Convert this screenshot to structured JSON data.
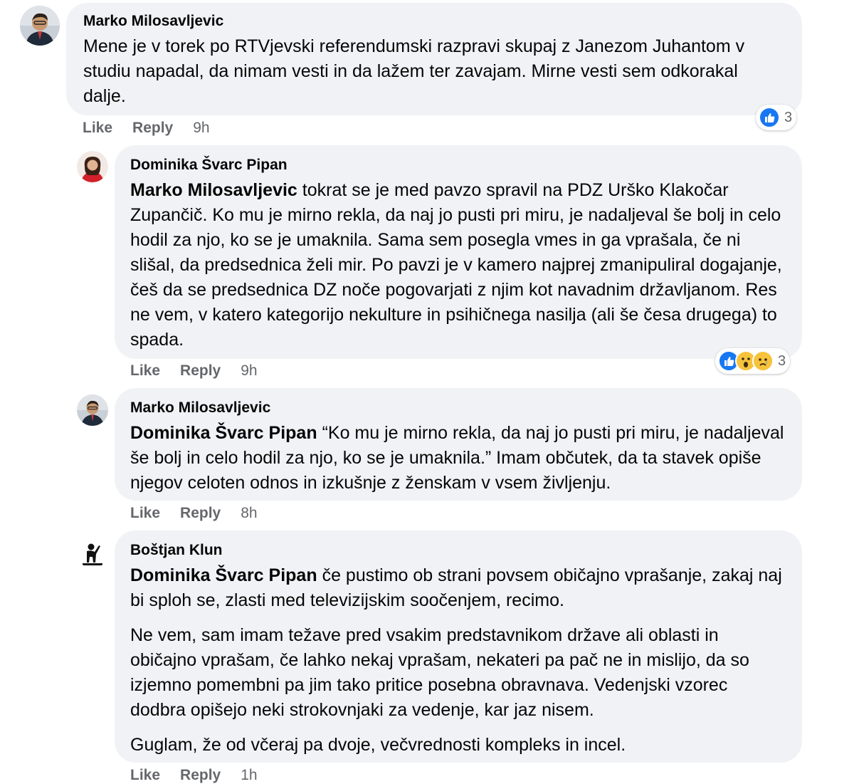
{
  "comments": [
    {
      "author": "Marko Milosavljevic",
      "mention": "",
      "paragraphs": [
        "Mene je v torek po RTVjevski referendumski razpravi skupaj z Janezom Juhantom v studiu napadal, da nimam vesti in da lažem ter zavajam. Mirne vesti sem odkorakal dalje."
      ],
      "like_label": "Like",
      "reply_label": "Reply",
      "time": "9h",
      "reactions": [
        "like-icon"
      ],
      "reaction_count": "3"
    },
    {
      "author": "Dominika Švarc Pipan",
      "mention": "Marko Milosavljevic",
      "paragraphs": [
        "tokrat se je med pavzo spravil na PDZ Urško Klakočar Zupančič. Ko mu je mirno rekla, da naj jo pusti pri miru, je nadaljeval še bolj in celo hodil za njo, ko se je umaknila. Sama sem posegla vmes in ga vprašala, če ni slišal, da predsednica želi mir. Po pavzi je v kamero najprej zmanipuliral dogajanje, češ da se predsednica DZ noče pogovarjati z njim kot navadnim državljanom. Res ne vem, v katero kategorijo nekulture in psihičnega nasilja (ali še česa drugega) to spada."
      ],
      "like_label": "Like",
      "reply_label": "Reply",
      "time": "9h",
      "reactions": [
        "like-icon",
        "wow-icon",
        "sad-icon"
      ],
      "reaction_count": "3"
    },
    {
      "author": "Marko Milosavljevic",
      "mention": "Dominika Švarc Pipan",
      "paragraphs": [
        "“Ko mu je mirno rekla, da naj jo pusti pri miru, je nadaljeval še bolj in celo hodil za njo, ko se je umaknila.” Imam občutek, da ta stavek opiše njegov celoten odnos in izkušnje z ženskam v vsem življenju."
      ],
      "like_label": "Like",
      "reply_label": "Reply",
      "time": "8h"
    },
    {
      "author": "Boštjan Klun",
      "mention": "Dominika Švarc Pipan",
      "paragraphs": [
        "če pustimo ob strani povsem običajno vprašanje, zakaj naj bi sploh se, zlasti med televizijskim soočenjem, recimo.",
        "Ne vem, sam imam težave pred vsakim predstavnikom države ali oblasti in običajno vprašam, če lahko nekaj vprašam, nekateri pa pač ne in mislijo, da so izjemno pomembni pa jim tako pritice posebna obravnava. Vedenjski vzorec dodbra opišejo neki strokovnjaki za vedenje, kar jaz nisem.",
        "Guglam, že od včeraj pa dvoje, večvrednosti kompleks in incel."
      ],
      "like_label": "Like",
      "reply_label": "Reply",
      "time": "1h"
    }
  ]
}
